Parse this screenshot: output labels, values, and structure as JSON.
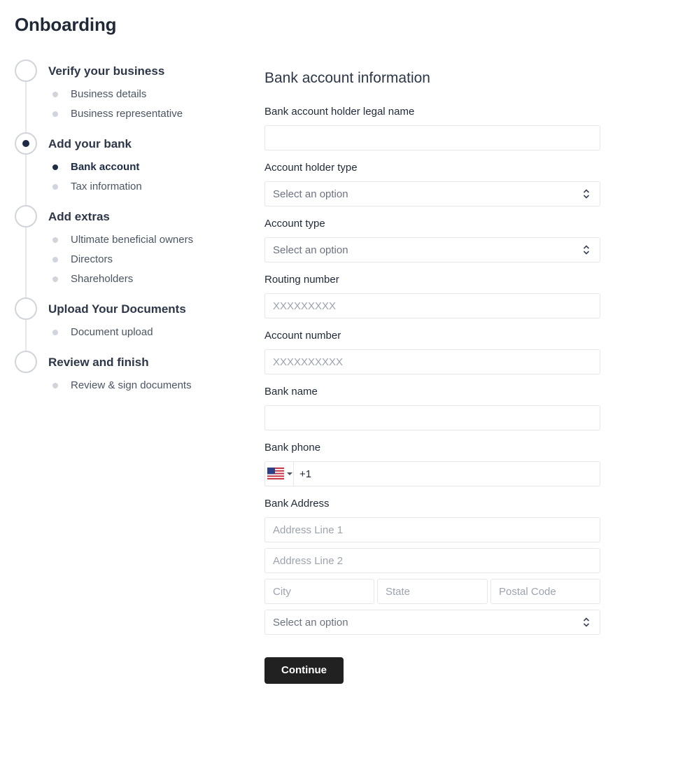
{
  "page": {
    "title": "Onboarding"
  },
  "stepper": {
    "steps": [
      {
        "title": "Verify your business",
        "active": false,
        "substeps": [
          {
            "label": "Business details",
            "active": false
          },
          {
            "label": "Business representative",
            "active": false
          }
        ]
      },
      {
        "title": "Add your bank",
        "active": true,
        "substeps": [
          {
            "label": "Bank account",
            "active": true
          },
          {
            "label": "Tax information",
            "active": false
          }
        ]
      },
      {
        "title": "Add extras",
        "active": false,
        "substeps": [
          {
            "label": "Ultimate beneficial owners",
            "active": false
          },
          {
            "label": "Directors",
            "active": false
          },
          {
            "label": "Shareholders",
            "active": false
          }
        ]
      },
      {
        "title": "Upload Your Documents",
        "active": false,
        "substeps": [
          {
            "label": "Document upload",
            "active": false
          }
        ]
      },
      {
        "title": "Review and finish",
        "active": false,
        "substeps": [
          {
            "label": "Review & sign documents",
            "active": false
          }
        ]
      }
    ]
  },
  "form": {
    "title": "Bank account information",
    "holder_name": {
      "label": "Bank account holder legal name",
      "value": "",
      "placeholder": ""
    },
    "holder_type": {
      "label": "Account holder type",
      "selected": "Select an option"
    },
    "account_type": {
      "label": "Account type",
      "selected": "Select an option"
    },
    "routing": {
      "label": "Routing number",
      "value": "",
      "placeholder": "XXXXXXXXX"
    },
    "account_number": {
      "label": "Account number",
      "value": "",
      "placeholder": "XXXXXXXXXX"
    },
    "bank_name": {
      "label": "Bank name",
      "value": "",
      "placeholder": ""
    },
    "bank_phone": {
      "label": "Bank phone",
      "country_icon": "us-flag-icon",
      "code": "+1"
    },
    "bank_address": {
      "label": "Bank Address",
      "line1_placeholder": "Address Line 1",
      "line2_placeholder": "Address Line 2",
      "city_placeholder": "City",
      "state_placeholder": "State",
      "postal_placeholder": "Postal Code",
      "country_selected": "Select an option"
    },
    "continue_label": "Continue"
  },
  "colors": {
    "accent": "#1e2b45",
    "button_bg": "#212121",
    "border": "#e5e7eb"
  }
}
